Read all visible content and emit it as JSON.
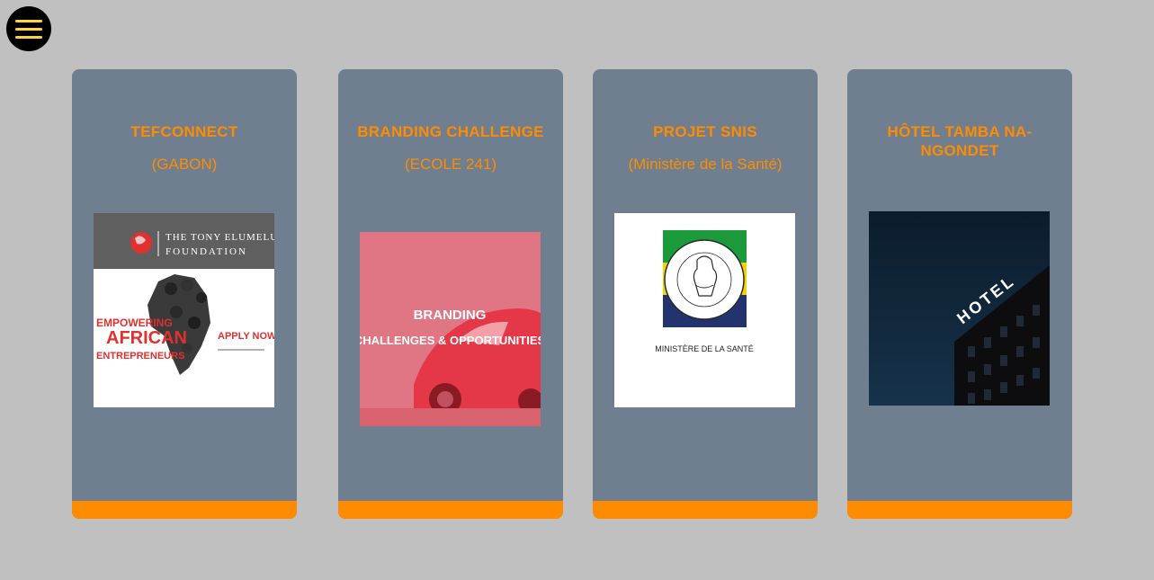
{
  "menu": {
    "icon": "hamburger-icon"
  },
  "colors": {
    "accent": "#ff8c00",
    "card_bg": "#707f8f",
    "page_bg": "#c0c0c0"
  },
  "cards": [
    {
      "title": "TEFCONNECT",
      "subtitle": "(GABON)",
      "image": {
        "header_line1": "THE TONY ELUMELU",
        "header_line2": "FOUNDATION",
        "text1": "EMPOWERING",
        "text2": "AFRICAN",
        "text3": "ENTREPRENEURS",
        "cta": "APPLY NOW"
      }
    },
    {
      "title": "BRANDING CHALLENGE",
      "subtitle": "(ECOLE 241)",
      "image": {
        "line1": "BRANDING",
        "line2": "CHALLENGES & OPPORTUNITIES"
      }
    },
    {
      "title": "PROJET SNIS",
      "subtitle": "(Ministère de la Santé)",
      "image": {
        "caption": "MINISTÈRE DE LA SANTÉ"
      }
    },
    {
      "title": "HÔTEL TAMBA NA-NGONDET",
      "subtitle": "",
      "image": {
        "sign": "HOTEL"
      }
    }
  ]
}
